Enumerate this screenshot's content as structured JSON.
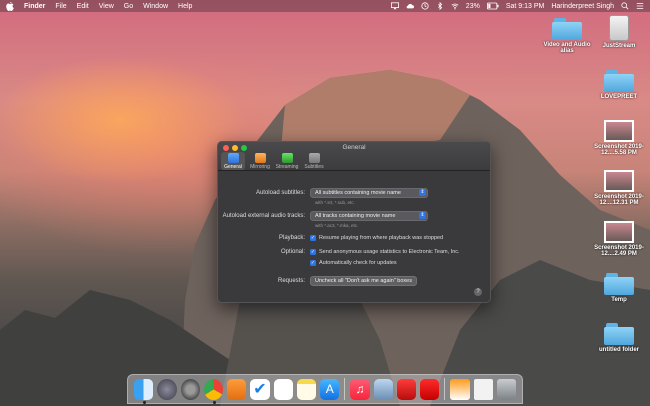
{
  "menubar": {
    "app_name": "Finder",
    "menus": [
      "File",
      "Edit",
      "View",
      "Go",
      "Window",
      "Help"
    ],
    "battery": "23%",
    "clock": "Sat 9:13 PM",
    "user": "Harinderpreet Singh"
  },
  "desktop": {
    "icons": [
      {
        "label": "Video and Audio alias",
        "icon": "folder-icon"
      },
      {
        "label": "JustStream",
        "icon": "drive-icon"
      },
      {
        "label": "LOVEPREET",
        "icon": "folder-icon"
      },
      {
        "label": "Screenshot 2019-12....5.58 PM",
        "icon": "screenshot-icon"
      },
      {
        "label": "Screenshot 2019-12....12.31 PM",
        "icon": "screenshot-icon"
      },
      {
        "label": "Screenshot 2019-12....2.49 PM",
        "icon": "screenshot-icon"
      },
      {
        "label": "Temp",
        "icon": "folder-icon"
      },
      {
        "label": "untitled folder",
        "icon": "folder-icon"
      }
    ]
  },
  "window": {
    "title": "General",
    "tabs": [
      {
        "label": "General",
        "icon": "monitor-icon",
        "active": true
      },
      {
        "label": "Mirroring",
        "icon": "mirroring-icon",
        "active": false
      },
      {
        "label": "Streaming",
        "icon": "streaming-icon",
        "active": false
      },
      {
        "label": "Subtitles",
        "icon": "subtitles-icon",
        "active": false
      }
    ],
    "autoload_subtitles": {
      "label": "Autoload subtitles:",
      "value": "All subtitles containing movie name",
      "hint": "with *.srt, *.sub, etc."
    },
    "autoload_audio": {
      "label": "Autoload external audio tracks:",
      "value": "All tracks containing movie name",
      "hint": "with *.ac3, *.mka, etc."
    },
    "playback": {
      "label": "Playback:",
      "option": "Resume playing from where playback was stopped"
    },
    "optional": {
      "label": "Optional:",
      "options": [
        "Send anonymous usage statistics to Electronic Team, Inc.",
        "Automatically check for updates"
      ]
    },
    "requests": {
      "label": "Requests:",
      "button": "Uncheck all \"Don't ask me again\" boxes"
    },
    "help": "?"
  },
  "dock": {
    "apps": [
      "finder-icon",
      "launchpad-icon",
      "system-preferences-icon",
      "chrome-icon",
      "sublime-icon",
      "tasks-icon",
      "reminders-icon",
      "notes-icon",
      "app-store-icon",
      "music-icon",
      "preview-icon",
      "creative-cloud-icon",
      "acrobat-icon",
      "vlc-icon",
      "document-icon",
      "trash-icon"
    ]
  },
  "colors": {
    "accent": "#2f74e0",
    "window_bg": "#3a3a3c"
  }
}
